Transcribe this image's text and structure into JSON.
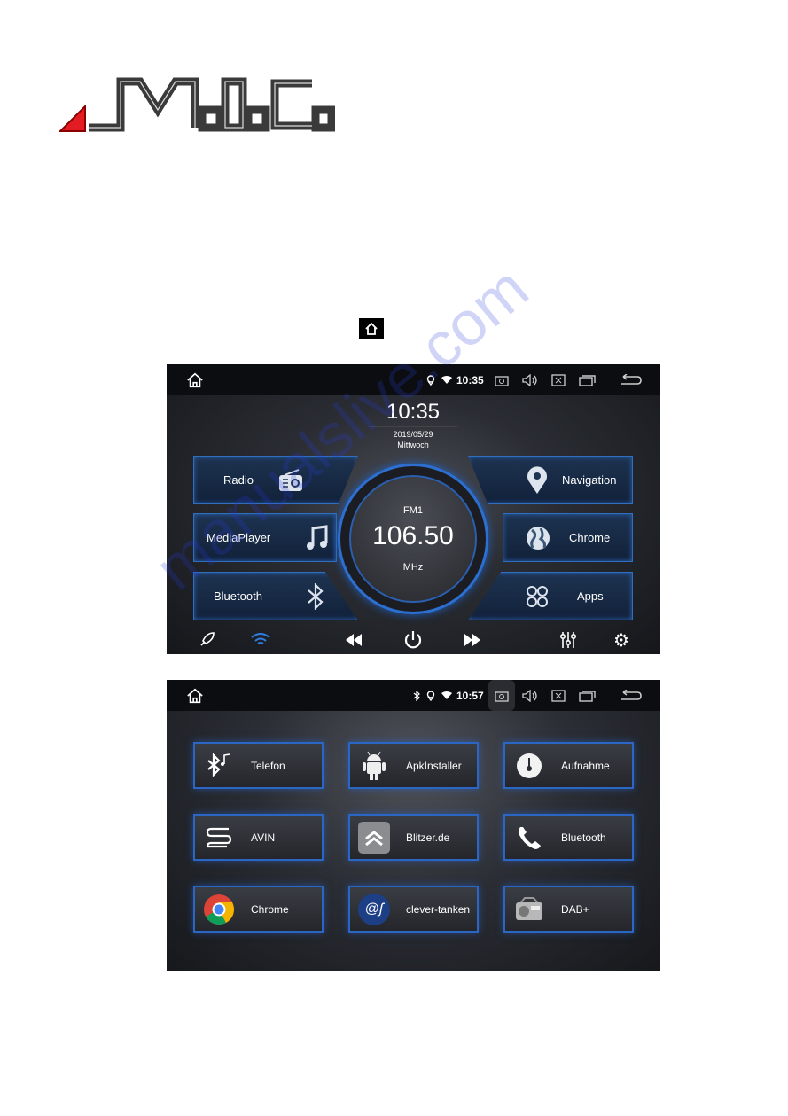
{
  "logo": {
    "text": "M.I.C."
  },
  "watermark": "manualslive.com",
  "screen1": {
    "status": {
      "time": "10:35"
    },
    "clock": {
      "time": "10:35",
      "date": "2019/05/29",
      "weekday": "Mittwoch"
    },
    "left_buttons": [
      {
        "label": "Radio",
        "icon": "radio-icon"
      },
      {
        "label": "MediaPlayer",
        "icon": "music-note-icon"
      },
      {
        "label": "Bluetooth",
        "icon": "bluetooth-icon"
      }
    ],
    "right_buttons": [
      {
        "label": "Navigation",
        "icon": "location-pin-icon"
      },
      {
        "label": "Chrome",
        "icon": "globe-icon"
      },
      {
        "label": "Apps",
        "icon": "apps-icon"
      }
    ],
    "radio": {
      "band": "FM1",
      "frequency": "106.50",
      "unit": "MHz"
    },
    "accent": "#2f6fc0"
  },
  "screen2": {
    "status": {
      "time": "10:57"
    },
    "tiles": [
      {
        "label": "Telefon",
        "icon": "bluetooth-music-icon"
      },
      {
        "label": "ApkInstaller",
        "icon": "android-icon"
      },
      {
        "label": "Aufnahme",
        "icon": "gauge-icon"
      },
      {
        "label": "AVIN",
        "icon": "cable-icon"
      },
      {
        "label": "Blitzer.de",
        "icon": "blitzer-icon"
      },
      {
        "label": "Bluetooth",
        "icon": "phone-icon"
      },
      {
        "label": "Chrome",
        "icon": "chrome-icon"
      },
      {
        "label": "clever-tanken",
        "icon": "clever-tanken-icon"
      },
      {
        "label": "DAB+",
        "icon": "radio-icon"
      }
    ]
  }
}
